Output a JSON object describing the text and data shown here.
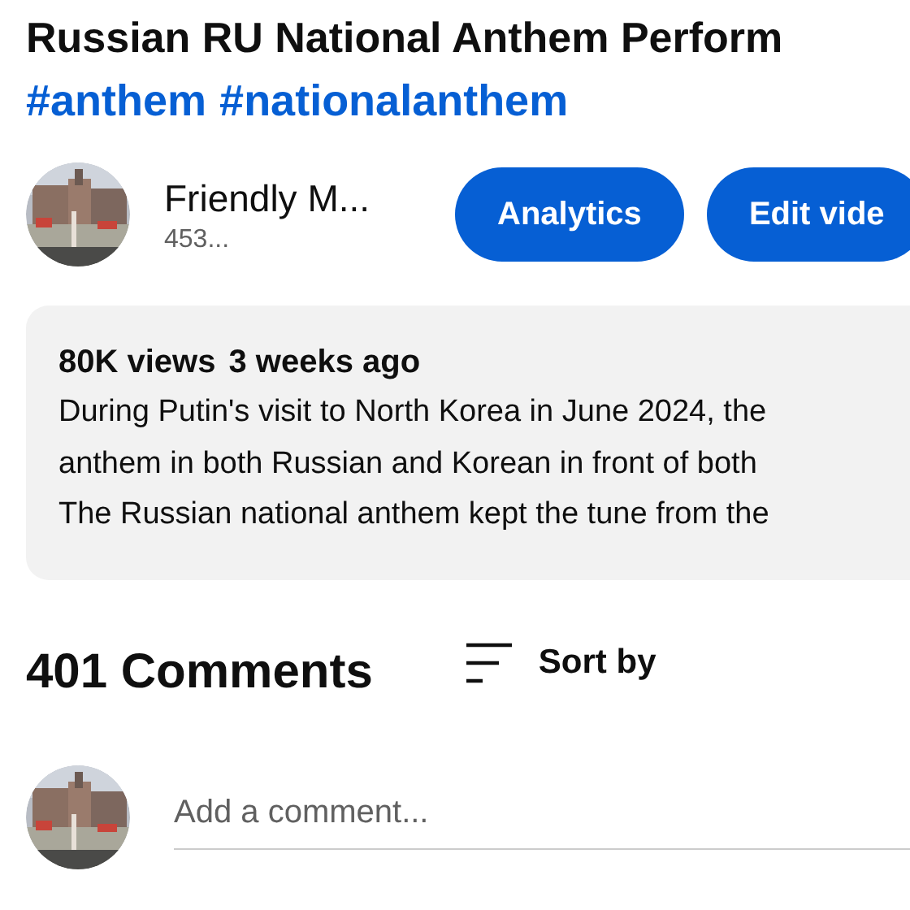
{
  "video": {
    "title": "Russian RU National Anthem Perform",
    "hashtags": [
      "#anthem",
      "#nationalanthem"
    ]
  },
  "channel": {
    "name": "Friendly M...",
    "subscribers": "453..."
  },
  "buttons": [
    "Analytics",
    "Edit vide"
  ],
  "description": {
    "views": "80K views",
    "date": "3 weeks ago",
    "lines": [
      "During Putin's visit to North Korea in June 2024, the",
      "anthem in both Russian and Korean in front of both",
      "The Russian national anthem kept the tune from the"
    ]
  },
  "comments": {
    "count": "401 Comments",
    "sort": "Sort by",
    "input": {
      "placeholder": "Add a comment..."
    }
  }
}
